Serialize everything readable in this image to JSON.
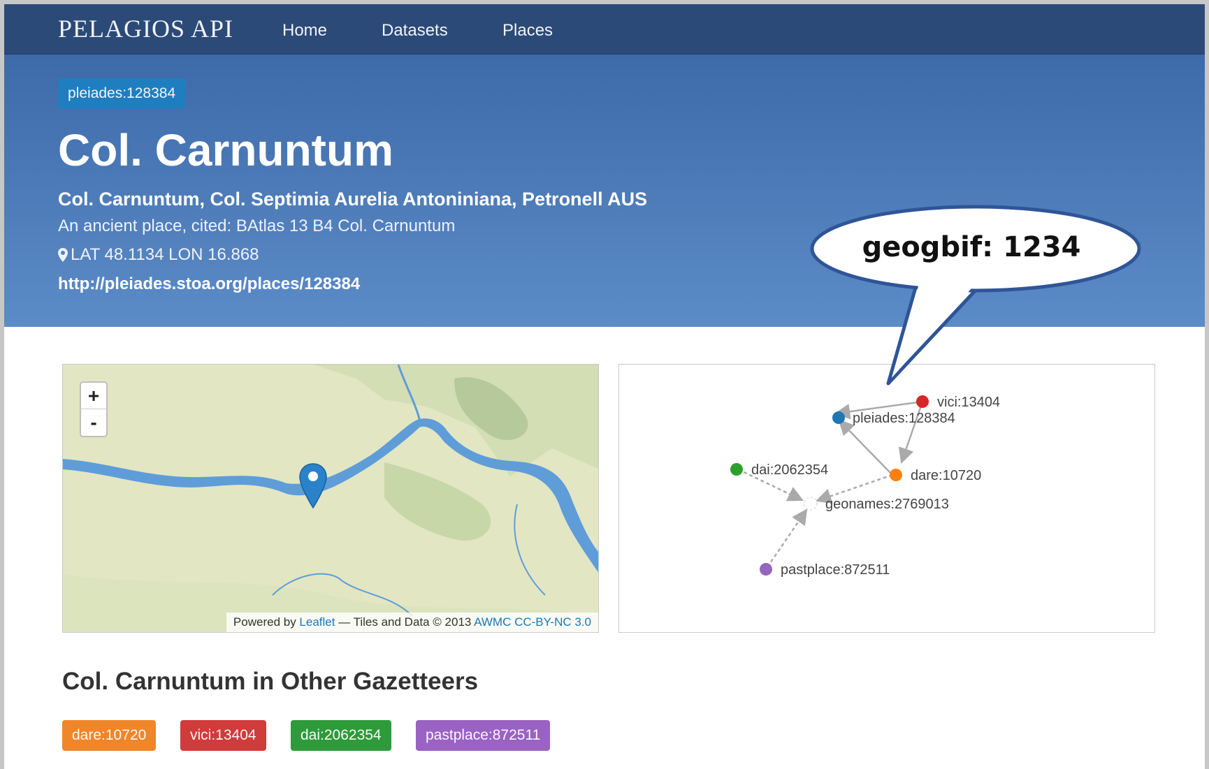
{
  "nav": {
    "brand": "PELAGIOS API",
    "links": [
      "Home",
      "Datasets",
      "Places"
    ]
  },
  "place": {
    "id_badge": "pleiades:128384",
    "title": "Col. Carnuntum",
    "alt_names": "Col. Carnuntum, Col. Septimia Aurelia Antoniniana, Petronell AUS",
    "description": "An ancient place, cited: BAtlas 13 B4 Col. Carnuntum",
    "coords": "LAT 48.1134 LON 16.868",
    "uri": "http://pleiades.stoa.org/places/128384"
  },
  "callout": {
    "text": "geogbif: 1234"
  },
  "map": {
    "zoom_in": "+",
    "zoom_out": "-",
    "attribution_prefix": "Powered by ",
    "attribution_leaflet": "Leaflet",
    "attribution_middle": " — Tiles and Data © 2013 ",
    "attribution_license": "AWMC CC-BY-NC 3.0",
    "marker_icon": "map-marker-icon"
  },
  "graph": {
    "nodes": [
      {
        "label": "vici:13404",
        "color": "#d62728"
      },
      {
        "label": "pleiades:128384",
        "color": "#1f77b4"
      },
      {
        "label": "dai:2062354",
        "color": "#2ca02c"
      },
      {
        "label": "dare:10720",
        "color": "#ff7f0e"
      },
      {
        "label": "geonames:2769013",
        "color": "#ffffff"
      },
      {
        "label": "pastplace:872511",
        "color": "#9467bd"
      }
    ]
  },
  "gazetteers": {
    "title": "Col. Carnuntum in Other Gazetteers",
    "tags": [
      {
        "label": "dare:10720",
        "color": "#f0862a"
      },
      {
        "label": "vici:13404",
        "color": "#d03b3b"
      },
      {
        "label": "dai:2062354",
        "color": "#2e9a3a"
      },
      {
        "label": "pastplace:872511",
        "color": "#9a62c2"
      }
    ]
  }
}
